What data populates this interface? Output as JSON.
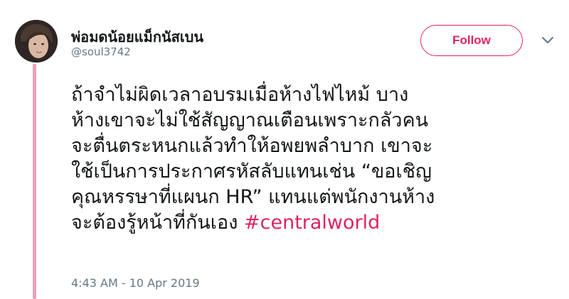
{
  "user": {
    "display_name": "พ่อมดน้อยแม็กนัสเบน",
    "handle": "@soul3742"
  },
  "follow_button": {
    "label": "Follow"
  },
  "tweet": {
    "lines": [
      "ถ้าจำไม่ผิดเวลาอบรมเมื่อห้างไฟไหม้ บาง",
      "ห้างเขาจะไม่ใช้สัญญาณเตือนเพราะกลัวคน",
      "จะตื่นตระหนกแล้วทำให้อพยพลำบาก เขาจะ",
      "ใช้เป็นการประกาศรหัสลับแทนเช่น “ขอเชิญ",
      "คุณหรรษาที่แผนก HR” แทนแต่พนักงานห้าง",
      "จะต้องรู้หน้าที่กันเอง "
    ],
    "hashtag": "#centralworld",
    "timestamp": "4:43 AM - 10 Apr 2019"
  },
  "colors": {
    "accent": "#e0245e",
    "thread_bar": "#e8a1bd",
    "secondary_text": "#657786",
    "primary_text": "#14171a"
  },
  "icons": {
    "more": "chevron-down-icon",
    "avatar": "avatar-image"
  }
}
